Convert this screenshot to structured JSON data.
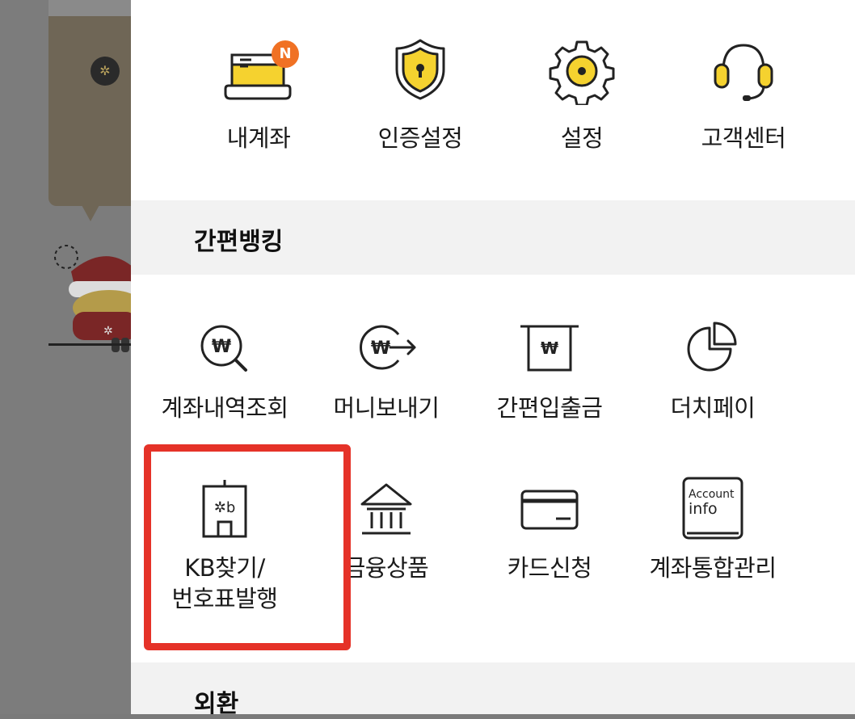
{
  "top_menu": [
    {
      "label": "내계좌",
      "icon": "account-card-icon",
      "badge": "N"
    },
    {
      "label": "인증설정",
      "icon": "shield-lock-icon"
    },
    {
      "label": "설정",
      "icon": "gear-icon"
    },
    {
      "label": "고객센터",
      "icon": "headset-icon"
    }
  ],
  "sections": {
    "easy_banking": {
      "title": "간편뱅킹",
      "items": [
        {
          "label": "계좌내역조회",
          "icon": "won-search-icon"
        },
        {
          "label": "머니보내기",
          "icon": "won-send-icon"
        },
        {
          "label": "간편입출금",
          "icon": "won-atm-icon"
        },
        {
          "label": "더치페이",
          "icon": "pie-chart-icon"
        },
        {
          "label_line1": "KB찾기/",
          "label_line2": "번호표발행",
          "icon": "kb-building-icon"
        },
        {
          "label": "금융상품",
          "icon": "bank-icon"
        },
        {
          "label": "카드신청",
          "icon": "credit-card-icon"
        },
        {
          "label": "계좌통합관리",
          "icon": "account-info-icon",
          "icon_text_1": "Account",
          "icon_text_2": "info"
        }
      ]
    },
    "forex": {
      "title": "외환"
    }
  },
  "colors": {
    "accent_yellow": "#f5d22f",
    "badge_orange": "#f07124",
    "highlight_red": "#e53228"
  }
}
